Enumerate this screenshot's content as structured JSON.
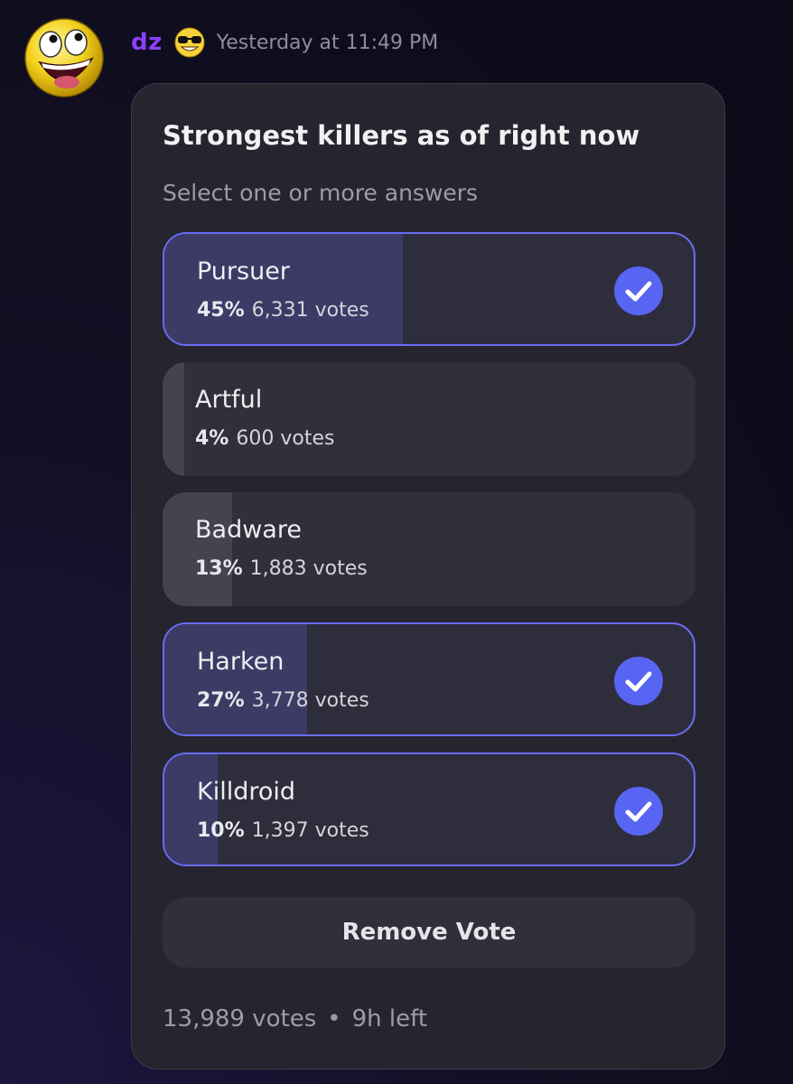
{
  "message": {
    "username": "dz",
    "timestamp": "Yesterday at 11:49 PM",
    "avatar_icon": "awesome-face-icon",
    "badge_icon": "sunglasses-face-icon"
  },
  "poll": {
    "question": "Strongest killers as of right now",
    "subtitle": "Select one or more answers",
    "options": [
      {
        "label": "Pursuer",
        "percent": "45%",
        "votes": "6,331 votes",
        "fill": 0.45,
        "selected": true
      },
      {
        "label": "Artful",
        "percent": "4%",
        "votes": "600 votes",
        "fill": 0.04,
        "selected": false
      },
      {
        "label": "Badware",
        "percent": "13%",
        "votes": "1,883 votes",
        "fill": 0.13,
        "selected": false
      },
      {
        "label": "Harken",
        "percent": "27%",
        "votes": "3,778 votes",
        "fill": 0.27,
        "selected": true
      },
      {
        "label": "Killdroid",
        "percent": "10%",
        "votes": "1,397 votes",
        "fill": 0.1,
        "selected": true
      }
    ],
    "remove_vote_label": "Remove Vote",
    "total_votes": "13,989 votes",
    "separator": "•",
    "time_left": "9h left"
  },
  "colors": {
    "accent": "#5865f2",
    "username": "#8a3ffc",
    "selected_border": "#6a6cf4"
  }
}
